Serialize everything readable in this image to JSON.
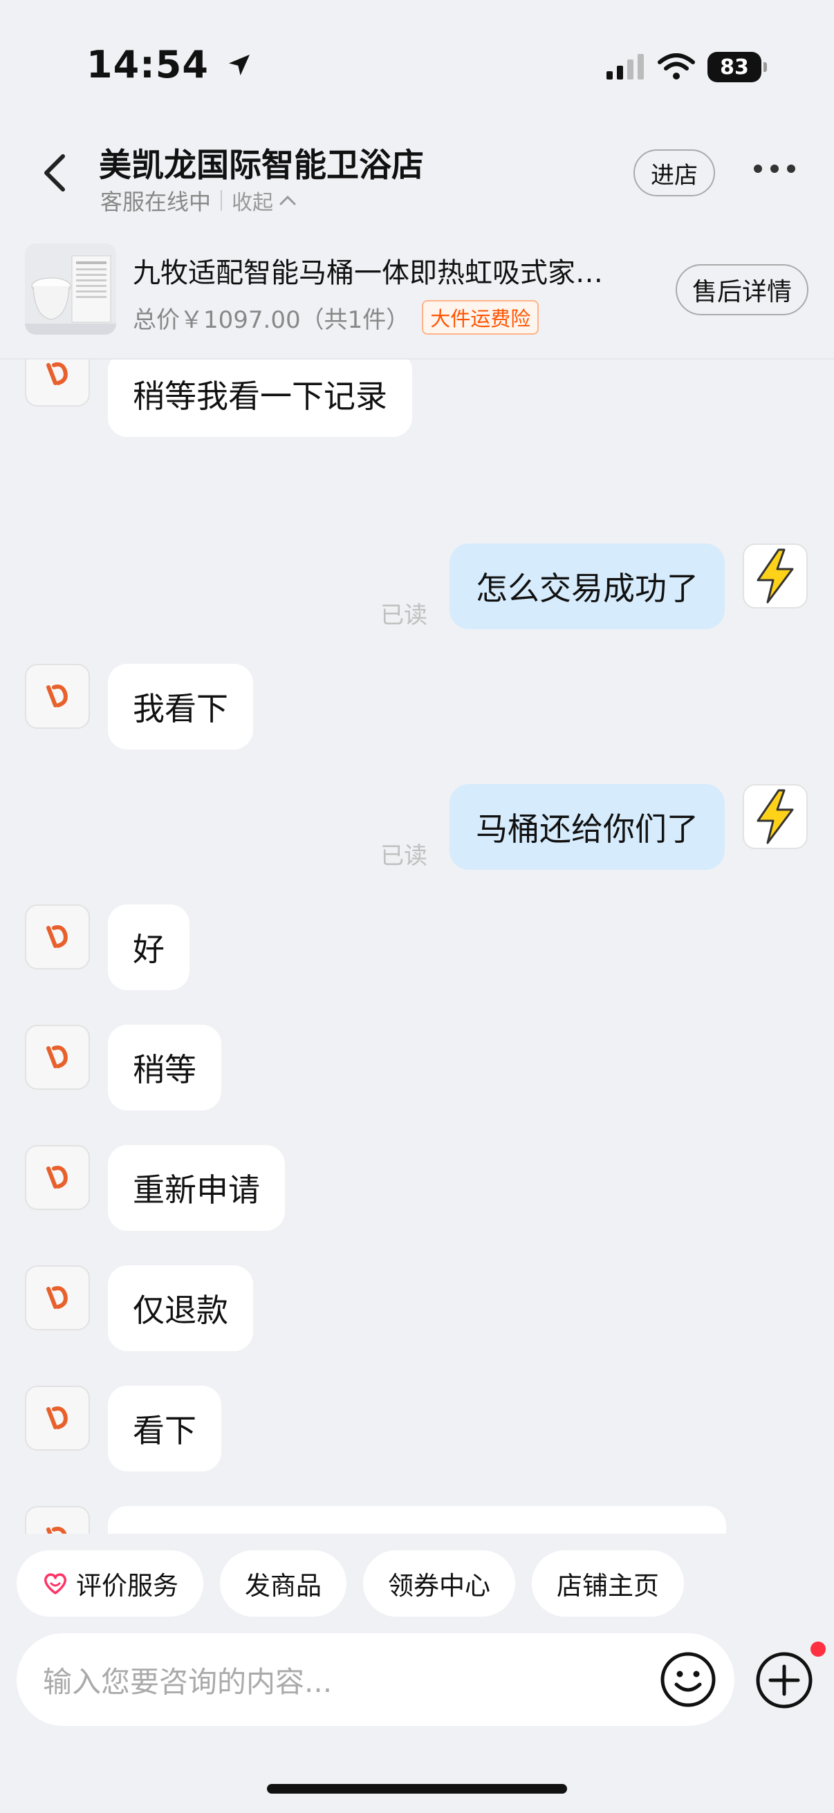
{
  "status_bar": {
    "time": "14:54",
    "battery": "83"
  },
  "header": {
    "title": "美凯龙国际智能卫浴店",
    "subtitle": "客服在线中",
    "collapse_label": "收起",
    "visit_label": "进店"
  },
  "product": {
    "name": "九牧适配智能马桶一体即热虹吸式家…",
    "price": "总价￥1097.00（共1件）",
    "tag": "大件运费险",
    "after_sale_label": "售后详情"
  },
  "messages": [
    {
      "side": "left",
      "text": "稍等我看一下记录"
    },
    {
      "side": "right",
      "text": "怎么交易成功了",
      "status": "已读"
    },
    {
      "side": "left",
      "text": "我看下"
    },
    {
      "side": "right",
      "text": "马桶还给你们了",
      "status": "已读"
    },
    {
      "side": "left",
      "text": "好"
    },
    {
      "side": "left",
      "text": "稍等"
    },
    {
      "side": "left",
      "text": "重新申请"
    },
    {
      "side": "left",
      "text": "仅退款"
    },
    {
      "side": "left",
      "text": "看下"
    },
    {
      "side": "left",
      "text": ""
    }
  ],
  "quick_actions": [
    {
      "label": "评价服务",
      "icon": "heart-icon"
    },
    {
      "label": "发商品"
    },
    {
      "label": "领券中心"
    },
    {
      "label": "店铺主页"
    }
  ],
  "input": {
    "placeholder": "输入您要咨询的内容..."
  },
  "colors": {
    "accent_orange": "#ff5500",
    "bubble_blue": "#d6ebfb",
    "bg": "#f0f1f5"
  }
}
